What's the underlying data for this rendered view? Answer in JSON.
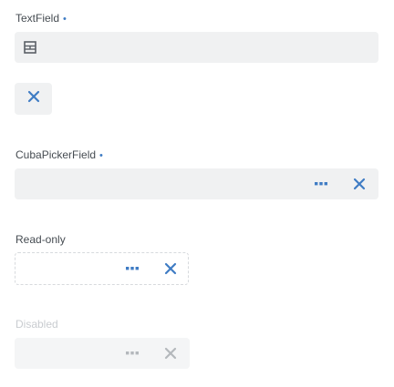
{
  "textfield": {
    "label": "TextField",
    "required_marker": "•",
    "icon": "table-grid-icon"
  },
  "standalone_button": {
    "icon": "close-icon"
  },
  "picker": {
    "label": "CubaPickerField",
    "required_marker": "•",
    "lookup_icon": "ellipsis-icon",
    "clear_icon": "close-icon"
  },
  "readonly": {
    "label": "Read-only",
    "lookup_icon": "ellipsis-icon",
    "clear_icon": "close-icon"
  },
  "disabled": {
    "label": "Disabled",
    "lookup_icon": "ellipsis-icon",
    "clear_icon": "close-icon"
  },
  "colors": {
    "accent": "#3f7cc4",
    "field_bg": "#f0f1f2",
    "label_text": "#464c52",
    "disabled_text": "#c9ccd0"
  }
}
